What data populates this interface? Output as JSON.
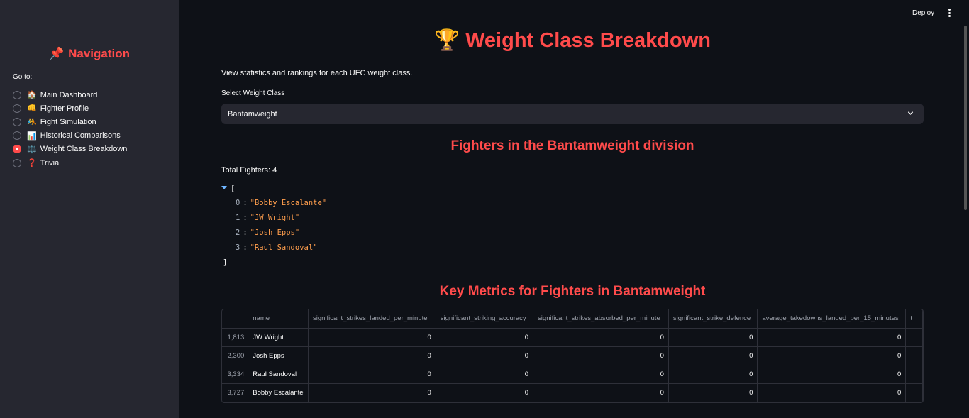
{
  "sidebar": {
    "title_icon": "📌",
    "title": "Navigation",
    "goto_label": "Go to:",
    "items": [
      {
        "emoji": "🏠",
        "label": "Main Dashboard",
        "selected": false
      },
      {
        "emoji": "👊",
        "label": "Fighter Profile",
        "selected": false
      },
      {
        "emoji": "🤼",
        "label": "Fight Simulation",
        "selected": false
      },
      {
        "emoji": "📊",
        "label": "Historical Comparisons",
        "selected": false
      },
      {
        "emoji": "⚖️",
        "label": "Weight Class Breakdown",
        "selected": true
      },
      {
        "emoji": "❓",
        "label": "Trivia",
        "selected": false
      }
    ]
  },
  "header": {
    "deploy_label": "Deploy",
    "menu_icon": "kebab-menu-icon"
  },
  "main": {
    "title_icon": "🏆",
    "title": "Weight Class Breakdown",
    "intro": "View statistics and rankings for each UFC weight class.",
    "select_label": "Select Weight Class",
    "select_value": "Bantamweight",
    "fighters_heading": "Fighters in the Bantamweight division",
    "total_fighters": "Total Fighters: 4",
    "json_open": "[",
    "json_close": "]",
    "fighter_list": [
      {
        "index": "0",
        "value": "\"Bobby Escalante\""
      },
      {
        "index": "1",
        "value": "\"JW Wright\""
      },
      {
        "index": "2",
        "value": "\"Josh Epps\""
      },
      {
        "index": "3",
        "value": "\"Raul Sandoval\""
      }
    ],
    "metrics_heading": "Key Metrics for Fighters in Bantamweight",
    "table": {
      "columns": [
        "",
        "name",
        "significant_strikes_landed_per_minute",
        "significant_striking_accuracy",
        "significant_strikes_absorbed_per_minute",
        "significant_strike_defence",
        "average_takedowns_landed_per_15_minutes",
        "t"
      ],
      "rows": [
        {
          "idx": "1,813",
          "name": "JW Wright",
          "vals": [
            "0",
            "0",
            "0",
            "0",
            "0"
          ]
        },
        {
          "idx": "2,300",
          "name": "Josh Epps",
          "vals": [
            "0",
            "0",
            "0",
            "0",
            "0"
          ]
        },
        {
          "idx": "3,334",
          "name": "Raul Sandoval",
          "vals": [
            "0",
            "0",
            "0",
            "0",
            "0"
          ]
        },
        {
          "idx": "3,727",
          "name": "Bobby Escalante",
          "vals": [
            "0",
            "0",
            "0",
            "0",
            "0"
          ]
        }
      ]
    }
  },
  "colors": {
    "accent": "#ff4b4b",
    "background": "#0e1117",
    "sidebar": "#262730"
  }
}
